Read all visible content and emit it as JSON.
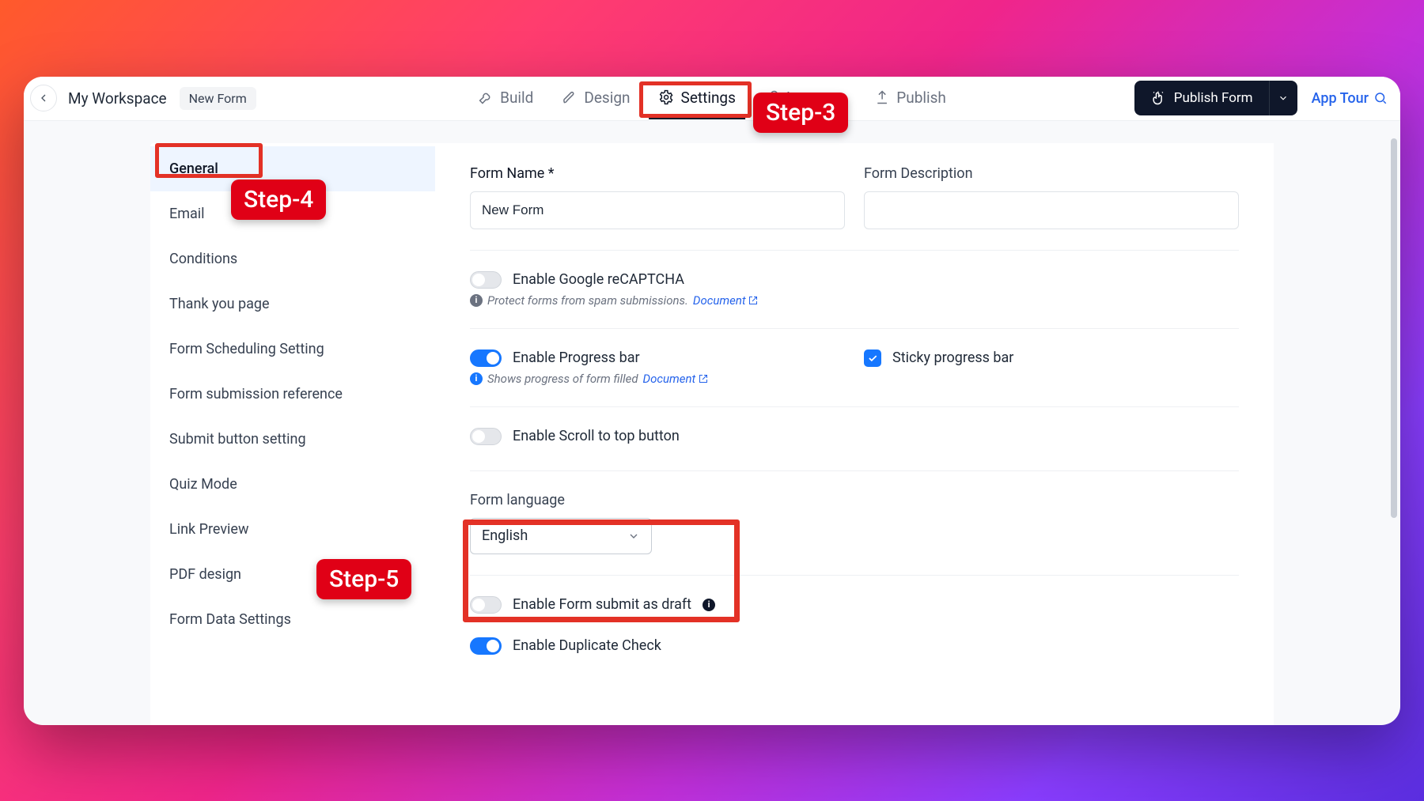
{
  "header": {
    "workspace": "My Workspace",
    "form_title": "New Form",
    "tabs": {
      "build": "Build",
      "design": "Design",
      "settings": "Settings",
      "integrate": "Integrate",
      "publish": "Publish"
    },
    "publish_button": "Publish Form",
    "app_tour": "App Tour"
  },
  "sidebar": {
    "items": [
      "General",
      "Email",
      "Conditions",
      "Thank you page",
      "Form Scheduling Setting",
      "Form submission reference",
      "Submit button setting",
      "Quiz Mode",
      "Link Preview",
      "PDF design",
      "Form Data Settings"
    ]
  },
  "form": {
    "name_label": "Form Name *",
    "name_value": "New Form",
    "desc_label": "Form Description",
    "desc_value": "",
    "recaptcha": {
      "label": "Enable Google reCAPTCHA",
      "hint": "Protect forms from spam submissions.",
      "doc": "Document"
    },
    "progress": {
      "label": "Enable Progress bar",
      "hint": "Shows progress of form filled",
      "doc": "Document",
      "sticky_label": "Sticky progress bar"
    },
    "scroll_top": {
      "label": "Enable Scroll to top button"
    },
    "language": {
      "label": "Form language",
      "value": "English"
    },
    "draft": {
      "label": "Enable Form submit as draft"
    },
    "duplicate": {
      "label": "Enable Duplicate Check"
    }
  },
  "callouts": {
    "step3": "Step-3",
    "step4": "Step-4",
    "step5": "Step-5"
  }
}
